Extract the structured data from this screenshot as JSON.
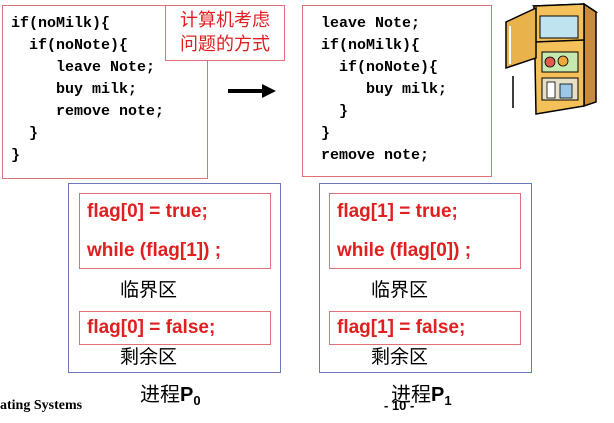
{
  "left_code": {
    "lines": [
      "if(noMilk){",
      "  if(noNote){",
      "     leave Note;",
      "     buy milk;",
      "     remove note;",
      "  }",
      "}"
    ]
  },
  "callout": {
    "line1": "计算机考虑",
    "line2": "问题的方式"
  },
  "right_code": {
    "lines": [
      "leave Note;",
      "if(noMilk){",
      "  if(noNote){",
      "     buy milk;",
      "  }",
      "}",
      "remove note;"
    ]
  },
  "process0": {
    "entry1": "flag[0] = true;",
    "entry2": "while (flag[1]) ;",
    "critical": "临界区",
    "exit": "flag[0] = false;",
    "remainder": "剩余区",
    "title_cn": "进程",
    "title_en": "P",
    "title_sub": "0"
  },
  "process1": {
    "entry1": "flag[1] = true;",
    "entry2": "while (flag[0]) ;",
    "critical": "临界区",
    "exit": "flag[1] = false;",
    "remainder": "剩余区",
    "title_cn": "进程",
    "title_en": "P",
    "title_sub": "1"
  },
  "footer": {
    "left_text": "ating Systems",
    "page": "- 10 -"
  },
  "icons": {
    "arrow": "right-arrow-icon",
    "fridge": "refrigerator-icon"
  },
  "colors": {
    "code_border": "#e0707a",
    "callout_text": "#e02020",
    "process_border": "#6a7ab8",
    "flag_text": "#e02020"
  }
}
